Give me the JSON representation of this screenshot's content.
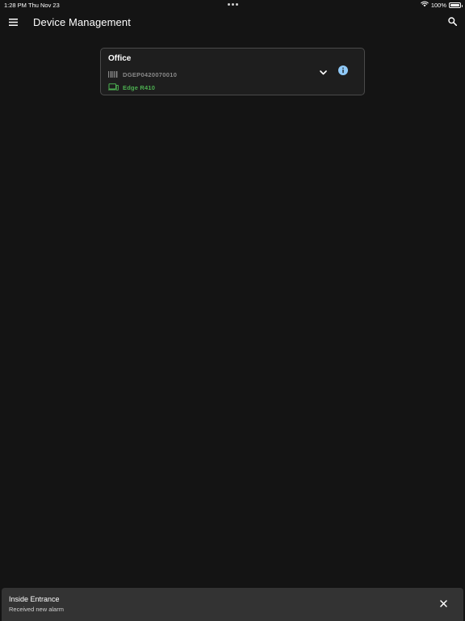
{
  "status_bar": {
    "time": "1:28 PM",
    "date": "Thu Nov 23",
    "battery": "100%",
    "battery_level": 1.0,
    "icons": [
      "more-dots-icon",
      "wifi-icon",
      "battery-icon"
    ]
  },
  "app_bar": {
    "title": "Device Management",
    "icons": [
      "menu-icon",
      "search-icon"
    ]
  },
  "devices": [
    {
      "name": "Office",
      "serial": "DGEP0420070010",
      "model": "Edge R410",
      "icons": [
        "barcode-icon",
        "devices-icon",
        "chevron-down-icon",
        "info-icon"
      ],
      "model_color": "#4caf50",
      "info_color": "#90caf9"
    }
  ],
  "snackbar": {
    "title": "Inside Entrance",
    "message": "Received new alarm",
    "icons": [
      "close-icon"
    ]
  },
  "colors": {
    "background": "#141414",
    "card_background": "#1e1e1e",
    "card_border": "#4a4a4a",
    "snackbar_background": "#333333"
  }
}
